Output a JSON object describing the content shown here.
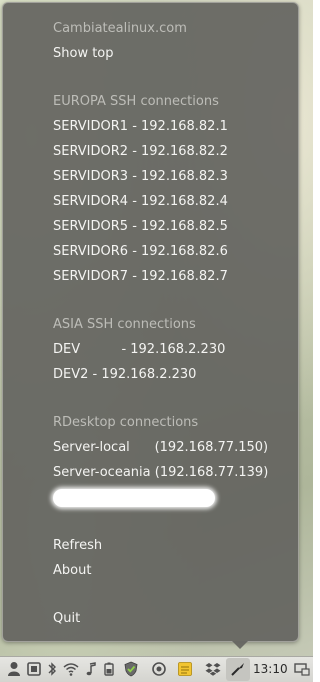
{
  "menu": {
    "site_title": "Cambiatealinux.com",
    "show_top": "Show top",
    "europa_header": "EUROPA SSH connections",
    "europa_items": [
      "SERVIDOR1 - 192.168.82.1",
      "SERVIDOR2 - 192.168.82.2",
      "SERVIDOR3 - 192.168.82.3",
      "SERVIDOR4 - 192.168.82.4",
      "SERVIDOR5 - 192.168.82.5",
      "SERVIDOR6 - 192.168.82.6",
      "SERVIDOR7 - 192.168.82.7"
    ],
    "asia_header": "ASIA SSH connections",
    "asia_items": [
      "DEV          - 192.168.2.230",
      "DEV2 - 192.168.2.230"
    ],
    "rdesktop_header": "RDesktop connections",
    "rdesktop_items": [
      "Server-local      (192.168.77.150)",
      "Server-oceania (192.168.77.139)"
    ],
    "refresh": "Refresh",
    "about": "About",
    "quit": "Quit"
  },
  "panel": {
    "clock": "13:10",
    "icons": [
      "user-icon",
      "screenshot-icon",
      "bluetooth-icon",
      "wifi-icon",
      "music-icon",
      "battery-icon",
      "shield-check-icon",
      "sync-icon",
      "notes-icon",
      "dropbox-icon",
      "ssh-menu-icon",
      "display-icon"
    ]
  },
  "colors": {
    "menu_bg": "#646460",
    "menu_text": "#f4f4f2",
    "menu_header_text": "#bdbdb8",
    "panel_bg": "#dcdcd8"
  }
}
